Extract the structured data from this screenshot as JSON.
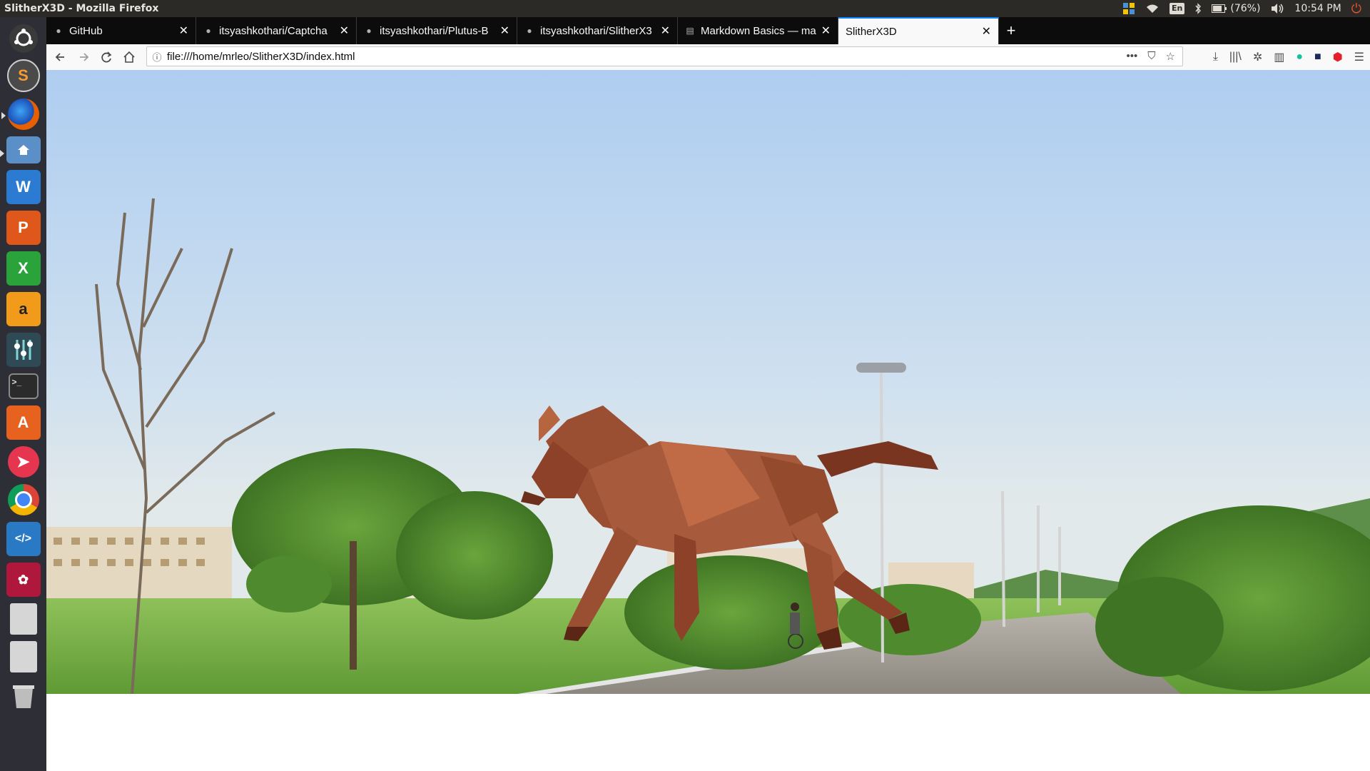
{
  "top_panel": {
    "window_title": "SlitherX3D - Mozilla Firefox",
    "battery": "(76%)",
    "clock": "10:54 PM",
    "keyboard_lang": "En"
  },
  "launcher": {
    "items": [
      {
        "name": "ubuntu-dash-icon",
        "color": "#3c3c3c"
      },
      {
        "name": "sublime-text-icon",
        "color": "#4d4d4d"
      },
      {
        "name": "firefox-icon",
        "color": "#e66000"
      },
      {
        "name": "files-icon",
        "color": "#5b8fc7"
      },
      {
        "name": "writer-icon",
        "color": "#2a7bd1"
      },
      {
        "name": "impress-icon",
        "color": "#e0571c"
      },
      {
        "name": "calc-icon",
        "color": "#2aa33a"
      },
      {
        "name": "amazon-icon",
        "color": "#f29b1b"
      },
      {
        "name": "mixer-icon",
        "color": "#2f4a55"
      },
      {
        "name": "terminal-icon",
        "color": "#2b2b2b"
      },
      {
        "name": "software-center-icon",
        "color": "#e7621f"
      },
      {
        "name": "send-icon",
        "color": "#e6364f"
      },
      {
        "name": "chrome-icon",
        "color": "#ffffff"
      },
      {
        "name": "vscode-icon",
        "color": "#2a79c4"
      },
      {
        "name": "mendeley-icon",
        "color": "#b0173d"
      },
      {
        "name": "drive-icon",
        "color": "#c9c9c9"
      },
      {
        "name": "drive-icon-2",
        "color": "#c9c9c9"
      },
      {
        "name": "trash-icon",
        "color": "#9e9e9e"
      }
    ]
  },
  "tabs": [
    {
      "label": "GitHub",
      "icon": "github-icon",
      "selected": false
    },
    {
      "label": "itsyashkothari/Captcha",
      "icon": "github-icon",
      "selected": false
    },
    {
      "label": "itsyashkothari/Plutus-B",
      "icon": "github-icon",
      "selected": false
    },
    {
      "label": "itsyashkothari/SlitherX3",
      "icon": "github-icon",
      "selected": false
    },
    {
      "label": "Markdown Basics — ma",
      "icon": "page-icon",
      "selected": false
    },
    {
      "label": "SlitherX3D",
      "icon": "",
      "selected": true
    }
  ],
  "navbar": {
    "url": "file:///home/mrleo/SlitherX3D/index.html"
  },
  "colors": {
    "tab_accent": "#0a84ff",
    "horse": "#a85a3c"
  }
}
